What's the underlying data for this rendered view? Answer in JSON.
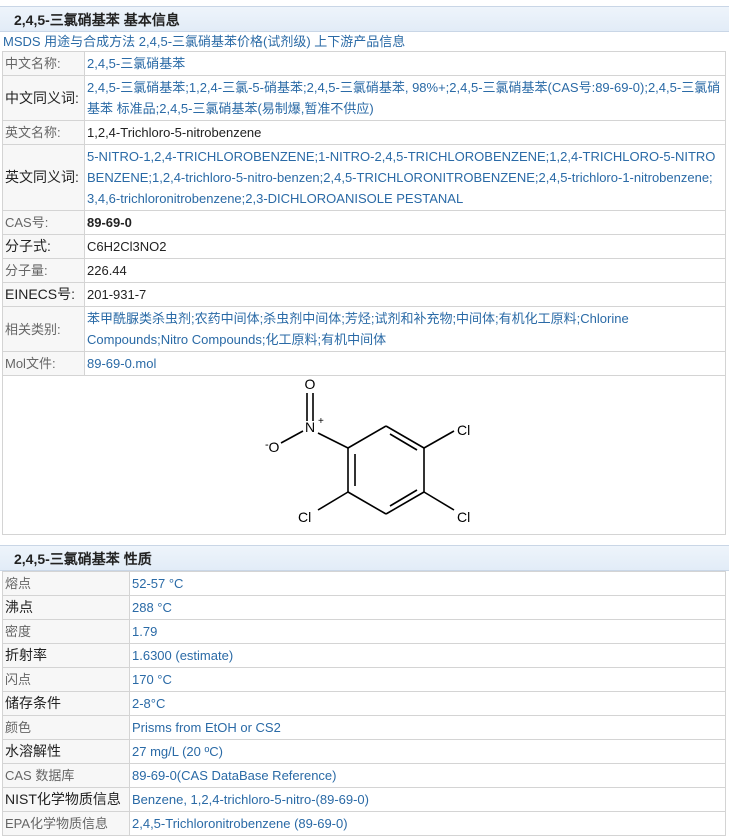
{
  "basic": {
    "header": "2,4,5-三氯硝基苯 基本信息",
    "subline": "MSDS 用途与合成方法 2,4,5-三氯硝基苯价格(试剂级) 上下游产品信息",
    "rows": [
      {
        "label": "中文名称:",
        "value": "2,4,5-三氯硝基苯"
      },
      {
        "label": "中文同义词:",
        "value": "2,4,5-三氯硝基苯;1,2,4-三氯-5-硝基苯;2,4,5-三氯硝基苯, 98%+;2,4,5-三氯硝基苯(CAS号:89-69-0);2,4,5-三氯硝基苯 标准品;2,4,5-三氯硝基苯(易制爆,暂准不供应)"
      },
      {
        "label": "英文名称:",
        "value": "1,2,4-Trichloro-5-nitrobenzene"
      },
      {
        "label": "英文同义词:",
        "value": "5-NITRO-1,2,4-TRICHLOROBENZENE;1-NITRO-2,4,5-TRICHLOROBENZENE;1,2,4-TRICHLORO-5-NITROBENZENE;1,2,4-trichloro-5-nitro-benzen;2,4,5-TRICHLORONITROBENZENE;2,4,5-trichloro-1-nitrobenzene;3,4,6-trichloronitrobenzene;2,3-DICHLOROANISOLE PESTANAL"
      },
      {
        "label": "CAS号:",
        "value": "89-69-0"
      },
      {
        "label": "分子式:",
        "value": "C6H2Cl3NO2"
      },
      {
        "label": "分子量:",
        "value": "226.44"
      },
      {
        "label": "EINECS号:",
        "value": "201-931-7"
      },
      {
        "label": "相关类别:",
        "value": "苯甲酰脲类杀虫剂;农药中间体;杀虫剂中间体;芳烃;试剂和补充物;中间体;有机化工原料;Chlorine Compounds;Nitro Compounds;化工原料;有机中间体"
      },
      {
        "label": "Mol文件:",
        "value": "89-69-0.mol"
      }
    ],
    "structure": {
      "o_top": "O",
      "n_label": "N",
      "n_charge": "+",
      "o_left": "O",
      "o_charge": "-",
      "cl_right_top": "Cl",
      "cl_right_bottom": "Cl",
      "cl_left_bottom": "Cl"
    }
  },
  "props": {
    "header": "2,4,5-三氯硝基苯 性质",
    "rows": [
      {
        "label": "熔点",
        "value": "52-57 °C"
      },
      {
        "label": "沸点",
        "value": "288 °C"
      },
      {
        "label": "密度",
        "value": "1.79"
      },
      {
        "label": "折射率",
        "value": "1.6300 (estimate)"
      },
      {
        "label": "闪点",
        "value": "170 °C"
      },
      {
        "label": "储存条件",
        "value": "2-8°C"
      },
      {
        "label": "颜色",
        "value": "Prisms from EtOH or CS2"
      },
      {
        "label": "水溶解性",
        "value": "27 mg/L (20 ºC)"
      },
      {
        "label": "CAS 数据库",
        "value": "89-69-0(CAS DataBase Reference)"
      },
      {
        "label": "NIST化学物质信息",
        "value": "Benzene, 1,2,4-trichloro-5-nitro-(89-69-0)"
      },
      {
        "label": "EPA化学物质信息",
        "value": "2,4,5-Trichloronitrobenzene (89-69-0)"
      }
    ]
  }
}
